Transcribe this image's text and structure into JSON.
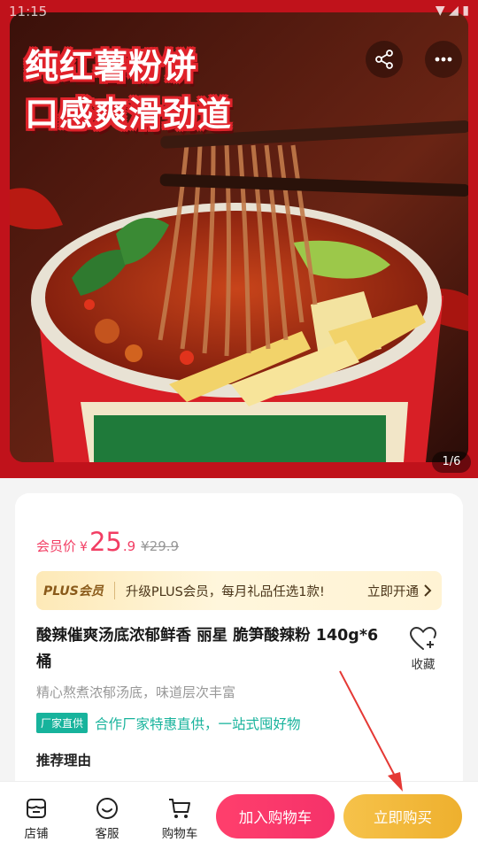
{
  "status_bar": {
    "time": "11:15"
  },
  "hero": {
    "title_line1": "纯红薯粉饼",
    "title_line2": "口感爽滑劲道",
    "page_indicator": "1/6",
    "accent_color": "#c0121b",
    "icons": [
      "back-arrow-icon",
      "share-icon",
      "more-icon"
    ]
  },
  "product": {
    "price_label": "会员价",
    "currency": "¥",
    "price_int": "25",
    "price_dec": ".9",
    "original_price": "¥29.9",
    "plus": {
      "badge": "PLUS会员",
      "text": "升级PLUS会员，每月礼品任选1款!",
      "action": "立即开通"
    },
    "title": "酸辣催爽汤底浓郁鲜香 丽星 脆笋酸辣粉 140g*6桶",
    "favorite_label": "收藏",
    "subtitle": "精心熬煮浓郁汤底，味道层次丰富",
    "tag_badge": "厂家直供",
    "tag_text": "合作厂家特惠直供，一站式囤好物",
    "reason_heading": "推荐理由"
  },
  "bottom_bar": {
    "store_label": "店铺",
    "service_label": "客服",
    "cart_label": "购物车",
    "add_to_cart": "加入购物车",
    "buy_now": "立即购买"
  },
  "colors": {
    "price": "#f23d63",
    "tag": "#17b39c",
    "cart_button": "#ff3f6c",
    "buy_button": "#f6c24a",
    "annotation_arrow": "#e53935"
  }
}
